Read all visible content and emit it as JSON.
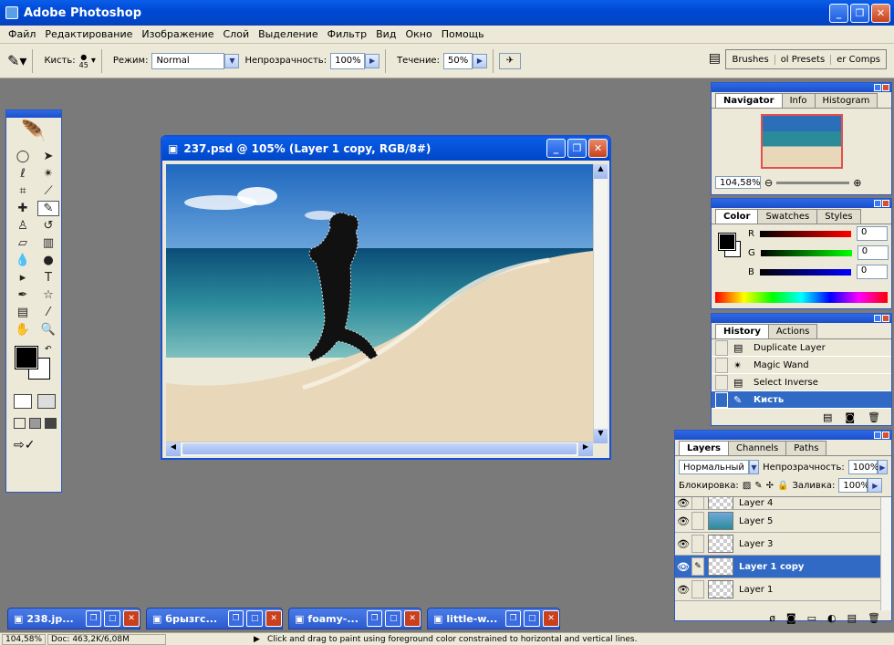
{
  "app": {
    "title": "Adobe Photoshop"
  },
  "menu": [
    "Файл",
    "Редактирование",
    "Изображение",
    "Слой",
    "Выделение",
    "Фильтр",
    "Вид",
    "Окно",
    "Помощь"
  ],
  "options": {
    "brush_label": "Кисть:",
    "brush_size": "45",
    "mode_label": "Режим:",
    "mode_value": "Normal",
    "opacity_label": "Непрозрачность:",
    "opacity_value": "100%",
    "flow_label": "Течение:",
    "flow_value": "50%"
  },
  "palette_well": [
    "Brushes",
    "ol Presets",
    "er Comps"
  ],
  "document": {
    "title": "237.psd @ 105% (Layer 1 copy, RGB/8#)"
  },
  "navigator": {
    "tabs": [
      "Navigator",
      "Info",
      "Histogram"
    ],
    "zoom": "104,58%"
  },
  "color": {
    "tabs": [
      "Color",
      "Swatches",
      "Styles"
    ],
    "r_label": "R",
    "g_label": "G",
    "b_label": "B",
    "r": "0",
    "g": "0",
    "b": "0"
  },
  "history": {
    "tabs": [
      "History",
      "Actions"
    ],
    "items": [
      "Duplicate Layer",
      "Magic Wand",
      "Select Inverse",
      "Кисть"
    ]
  },
  "layers": {
    "tabs": [
      "Layers",
      "Channels",
      "Paths"
    ],
    "blend_mode": "Нормальный",
    "opacity_label": "Непрозрачность:",
    "opacity_value": "100%",
    "lock_label": "Блокировка:",
    "fill_label": "Заливка:",
    "fill_value": "100%",
    "items": [
      "Layer 4",
      "Layer 5",
      "Layer 3",
      "Layer 1 copy",
      "Layer 1"
    ]
  },
  "minimized": [
    "238.jp...",
    "брызгс...",
    "foamy-...",
    "little-w..."
  ],
  "status": {
    "zoom": "104,58%",
    "doc": "Doc: 463,2K/6,08M",
    "hint": "Click and drag to paint using foreground color constrained to horizontal and vertical lines."
  },
  "colors": {
    "xp_blue": "#0046c8",
    "highlight": "#316ac5",
    "workspace": "#7a7a7a"
  }
}
